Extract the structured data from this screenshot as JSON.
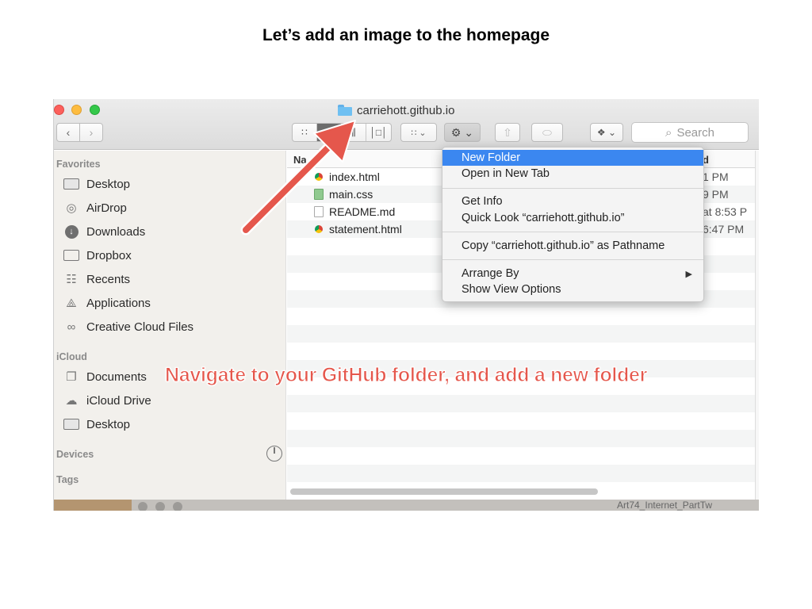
{
  "slide_title": "Let’s add an image to the homepage",
  "window": {
    "title": "carriehott.github.io",
    "colors": {
      "close": "#fc605c",
      "minimize": "#fdbc40",
      "zoom": "#34c84a",
      "folder_blue": "#6fc0f2"
    }
  },
  "toolbar": {
    "back_icon": "chevron-left-icon",
    "forward_icon": "chevron-right-icon",
    "view_modes": [
      "icon-view",
      "list-view",
      "column-view",
      "cover-flow-view"
    ],
    "active_view": "list-view",
    "search_placeholder": "Search"
  },
  "sidebar": {
    "favorites_header": "Favorites",
    "favorites": [
      {
        "label": "Desktop",
        "icon": "desktop-icon"
      },
      {
        "label": "AirDrop",
        "icon": "airdrop-icon"
      },
      {
        "label": "Downloads",
        "icon": "downloads-icon"
      },
      {
        "label": "Dropbox",
        "icon": "folder-icon"
      },
      {
        "label": "Recents",
        "icon": "recents-icon"
      },
      {
        "label": "Applications",
        "icon": "applications-icon"
      },
      {
        "label": "Creative Cloud Files",
        "icon": "creative-cloud-icon"
      }
    ],
    "icloud_header": "iCloud",
    "icloud": [
      {
        "label": "Documents",
        "icon": "documents-icon"
      },
      {
        "label": "iCloud Drive",
        "icon": "cloud-icon"
      },
      {
        "label": "Desktop",
        "icon": "desktop-icon"
      }
    ],
    "devices_header": "Devices",
    "tags_header": "Tags"
  },
  "filelist": {
    "name_header": "Na",
    "date_header": "d",
    "files": [
      {
        "name": "index.html",
        "date": "1 PM",
        "icon": "chrome-document-icon"
      },
      {
        "name": "main.css",
        "date": "9 PM",
        "icon": "css-file-icon"
      },
      {
        "name": "README.md",
        "date": "at 8:53 P",
        "icon": "text-document-icon"
      },
      {
        "name": "statement.html",
        "date": "6:47 PM",
        "icon": "chrome-document-icon"
      }
    ]
  },
  "context_menu": {
    "new_folder": "New Folder",
    "open_new_tab": "Open in New Tab",
    "get_info": "Get Info",
    "quick_look": "Quick Look “carriehott.github.io”",
    "copy_pathname": "Copy “carriehott.github.io” as Pathname",
    "arrange_by": "Arrange By",
    "show_view_options": "Show View Options",
    "highlight_color": "#3b87f0"
  },
  "annotation": {
    "text": "Navigate to your GitHub folder, and add a new folder",
    "color": "#e5574c"
  },
  "background_window": {
    "partial_title": "Art74_Internet_PartTw"
  }
}
